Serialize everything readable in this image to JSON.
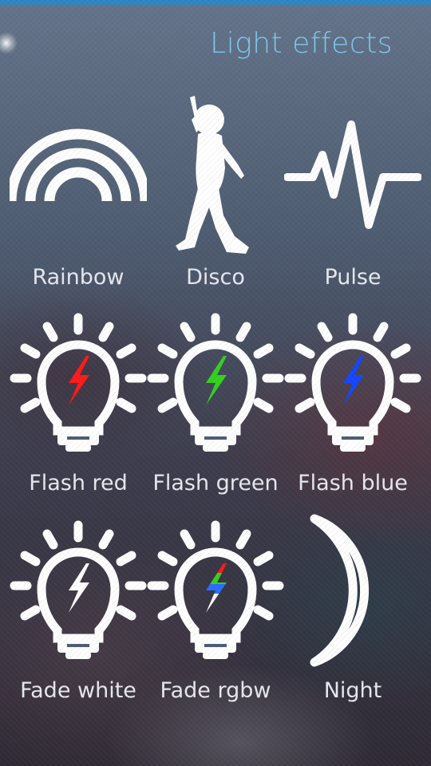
{
  "header": {
    "title": "Light effects"
  },
  "effects": [
    {
      "label": "Rainbow",
      "icon": "rainbow-icon"
    },
    {
      "label": "Disco",
      "icon": "disco-dancer-icon"
    },
    {
      "label": "Pulse",
      "icon": "pulse-icon"
    },
    {
      "label": "Flash red",
      "icon": "bulb-flash-icon",
      "color": "#ff1a1a"
    },
    {
      "label": "Flash green",
      "icon": "bulb-flash-icon",
      "color": "#35d020"
    },
    {
      "label": "Flash blue",
      "icon": "bulb-flash-icon",
      "color": "#1447ff"
    },
    {
      "label": "Fade white",
      "icon": "bulb-flash-icon",
      "color": "#ffffff"
    },
    {
      "label": "Fade rgbw",
      "icon": "bulb-flash-rgbw-icon",
      "colors": [
        "#ff1a1a",
        "#35d020",
        "#2a6dff",
        "#ffffff"
      ]
    },
    {
      "label": "Night",
      "icon": "moon-icon"
    }
  ],
  "colors": {
    "accent": "#7dc8ec",
    "topbar": "#2e86c1",
    "icon": "#ffffff",
    "label": "#e6e8ee"
  }
}
